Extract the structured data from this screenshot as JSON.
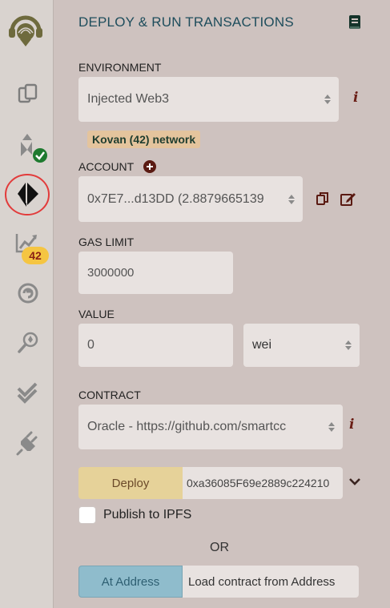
{
  "sidebar": {
    "logo": "remix-logo-icon",
    "items": [
      {
        "icon": "file-explorer-icon"
      },
      {
        "icon": "compiler-icon",
        "status": "check"
      },
      {
        "icon": "ethereum-deploy-icon",
        "active": true
      },
      {
        "icon": "analytics-icon",
        "badge": "42"
      },
      {
        "icon": "debugger-icon"
      },
      {
        "icon": "search-icon"
      },
      {
        "icon": "test-icon"
      },
      {
        "icon": "plugin-icon"
      }
    ]
  },
  "panel": {
    "title": "DEPLOY & RUN TRANSACTIONS",
    "docs_icon": "book-icon"
  },
  "environment": {
    "label": "ENVIRONMENT",
    "value": "Injected Web3",
    "network_badge": "Kovan (42) network"
  },
  "account": {
    "label": "ACCOUNT",
    "value": "0x7E7...d13DD (2.8879665139"
  },
  "gas_limit": {
    "label": "GAS LIMIT",
    "value": "3000000"
  },
  "value": {
    "label": "VALUE",
    "amount": "0",
    "unit": "wei"
  },
  "contract": {
    "label": "CONTRACT",
    "value": "Oracle - https://github.com/smartcc"
  },
  "deploy": {
    "button": "Deploy",
    "args": "0xa36085F69e2889c224210"
  },
  "publish": {
    "label": "Publish to IPFS"
  },
  "or_text": "OR",
  "at_address": {
    "button": "At Address",
    "placeholder": "Load contract from Address"
  },
  "colors": {
    "accent": "#1e4d5c",
    "deploy_button": "#e6d299",
    "at_address_button": "#8fbccc",
    "badge": "#e4c49d",
    "check": "#1e7a2f",
    "active_ring": "#e23b3b"
  }
}
